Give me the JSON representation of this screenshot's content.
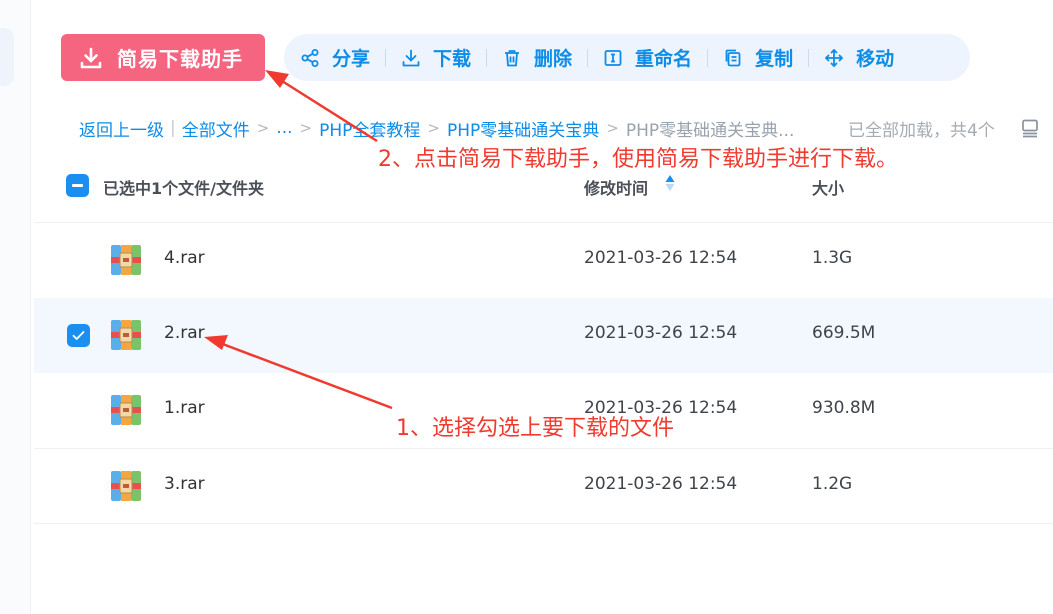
{
  "primary_action": {
    "label": "简易下载助手",
    "color": "#f5657f"
  },
  "toolbar": {
    "share": "分享",
    "download": "下载",
    "delete": "删除",
    "rename": "重命名",
    "copy": "复制",
    "move": "移动",
    "accent": "#0d8ce8"
  },
  "breadcrumb": {
    "back": "返回上一级",
    "root": "全部文件",
    "ellipsis": "...",
    "level1": "PHP全套教程",
    "level2": "PHP零基础通关宝典",
    "current": "PHP零基础通关宝典..."
  },
  "load_status": "已全部加载，共4个",
  "table": {
    "selection_label": "已选中1个文件/文件夹",
    "col_modified": "修改时间",
    "col_size": "大小",
    "rows": [
      {
        "name": "4.rar",
        "modified": "2021-03-26 12:54",
        "size": "1.3G",
        "selected": false
      },
      {
        "name": "2.rar",
        "modified": "2021-03-26 12:54",
        "size": "669.5M",
        "selected": true
      },
      {
        "name": "1.rar",
        "modified": "2021-03-26 12:54",
        "size": "930.8M",
        "selected": false
      },
      {
        "name": "3.rar",
        "modified": "2021-03-26 12:54",
        "size": "1.2G",
        "selected": false
      }
    ]
  },
  "annotations": {
    "step1": "1、选择勾选上要下载的文件",
    "step2": "2、点击简易下载助手，使用简易下载助手进行下载。",
    "color": "#f03a30"
  },
  "icons": {
    "primary": "download-icon",
    "share": "share-icon",
    "download": "download-icon",
    "delete": "trash-icon",
    "rename": "rename-icon",
    "copy": "copy-icon",
    "move": "move-icon",
    "file": "archive-file-icon",
    "sort": "sort-icon",
    "view": "list-view-icon"
  }
}
